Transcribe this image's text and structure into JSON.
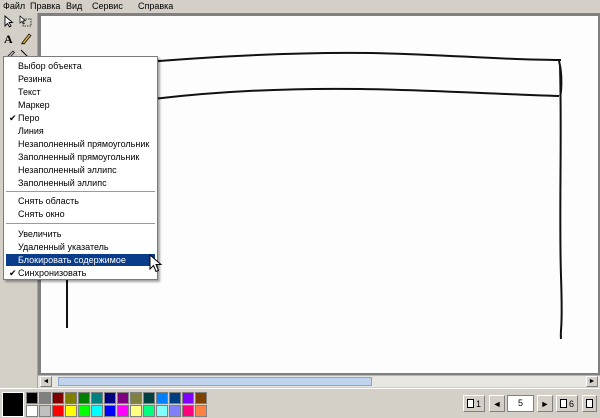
{
  "menubar": {
    "items": [
      "Файл",
      "Правка",
      "Вид",
      "Сервис",
      "Справка"
    ]
  },
  "context_menu": {
    "group1": [
      {
        "label": "Выбор объекта",
        "checked": false
      },
      {
        "label": "Резинка",
        "checked": false
      },
      {
        "label": "Текст",
        "checked": false
      },
      {
        "label": "Маркер",
        "checked": false
      },
      {
        "label": "Перо",
        "checked": true
      },
      {
        "label": "Линия",
        "checked": false
      },
      {
        "label": "Незаполненный прямоугольник",
        "checked": false
      },
      {
        "label": "Заполненный прямоугольник",
        "checked": false
      },
      {
        "label": "Незаполненный эллипс",
        "checked": false
      },
      {
        "label": "Заполненный эллипс",
        "checked": false
      }
    ],
    "group2": [
      {
        "label": "Снять область"
      },
      {
        "label": "Снять окно"
      }
    ],
    "group3": [
      {
        "label": "Увеличить",
        "checked": false
      },
      {
        "label": "Удаленный указатель",
        "checked": false
      },
      {
        "label": "Блокировать содержимое",
        "checked": false,
        "highlighted": true
      },
      {
        "label": "Синхронизовать",
        "checked": true
      }
    ],
    "check_glyph": "✔"
  },
  "status": {
    "current_color": "#000000",
    "page_first": "1",
    "page_current": "5",
    "page_last": "6",
    "prev_arrow": "◄",
    "next_arrow": "►"
  },
  "scrollbar": {
    "left_arrow": "◄",
    "right_arrow": "►"
  },
  "palette": [
    "#000000",
    "#808080",
    "#800000",
    "#808000",
    "#008000",
    "#008080",
    "#000080",
    "#800080",
    "#808040",
    "#004040",
    "#0080ff",
    "#004080",
    "#8000ff",
    "#804000",
    "#ffffff",
    "#c0c0c0",
    "#ff0000",
    "#ffff00",
    "#00ff00",
    "#00ffff",
    "#0000ff",
    "#ff00ff",
    "#ffff80",
    "#00ff80",
    "#80ffff",
    "#8080ff",
    "#ff0080",
    "#ff8040"
  ],
  "tools": [
    {
      "name": "select-arrow-icon"
    },
    {
      "name": "select-area-icon"
    },
    {
      "name": "text-tool-icon"
    },
    {
      "name": "marker-tool-icon"
    },
    {
      "name": "pen-tool-icon"
    },
    {
      "name": "line-tool-icon"
    }
  ]
}
